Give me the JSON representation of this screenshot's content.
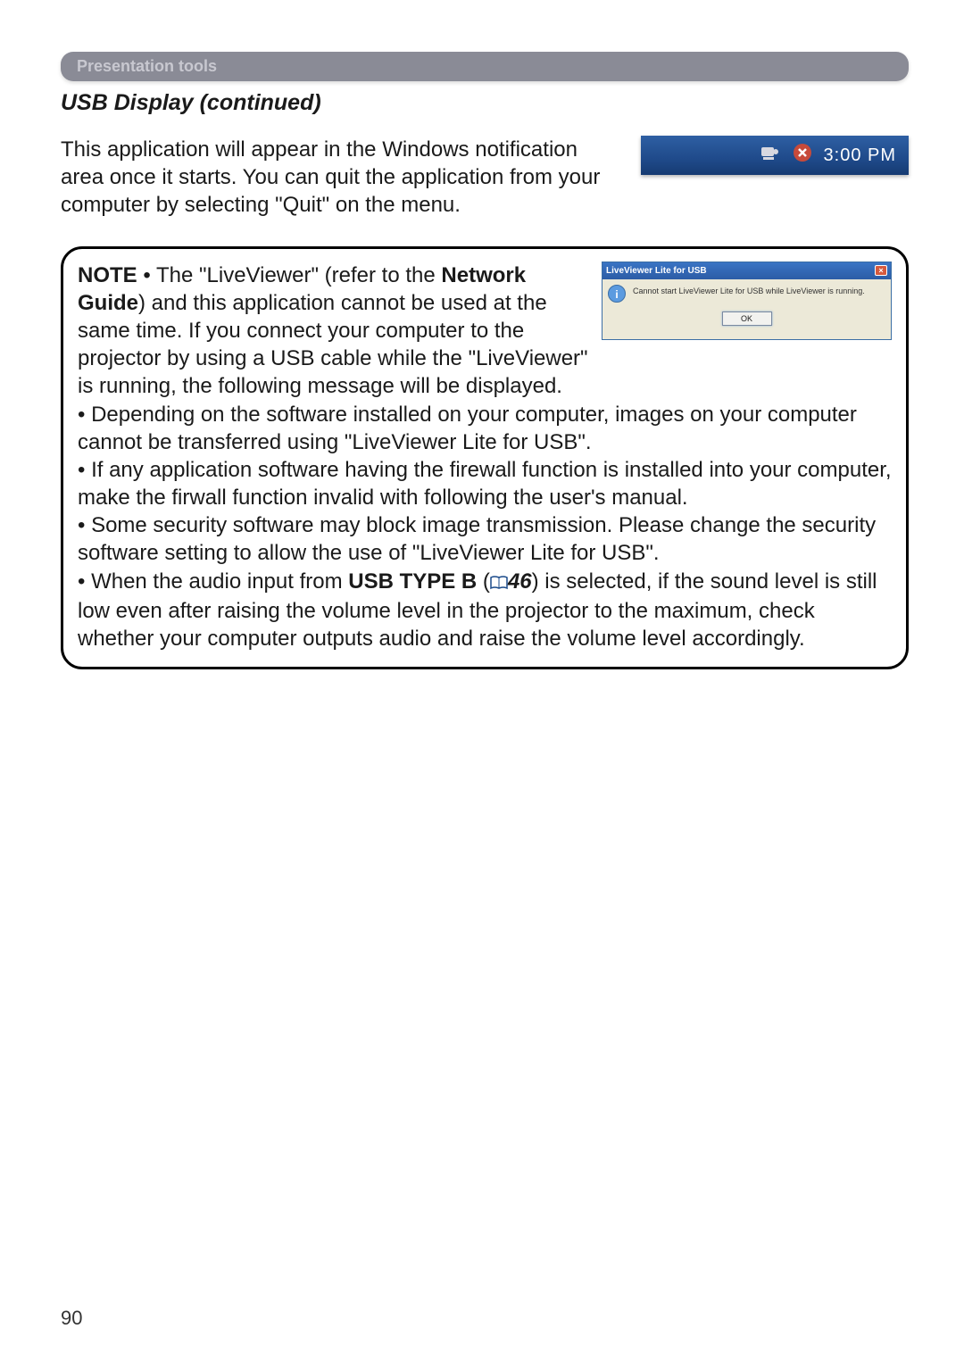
{
  "section_header": "Presentation tools",
  "page_title": "USB Display (continued)",
  "intro": "This application will appear in the Windows notification area once it starts. You can quit the application from your computer by selecting \"Quit\" on the menu.",
  "tray": {
    "time": "3:00 PM"
  },
  "dialog": {
    "title": "LiveViewer Lite for USB",
    "message": "Cannot start LiveViewer Lite for USB while LiveViewer is running.",
    "ok_label": "OK",
    "close_label": "×"
  },
  "note": {
    "label": "NOTE",
    "line1_prefix": "  • The \"LiveViewer\" (refer to the ",
    "bold1": "Network Guide",
    "line1_after": ") and this application cannot be used at the same time. If you connect your computer to the projector by using a USB cable while the \"LiveViewer\" is running, the following message will be displayed.",
    "bullet2": "• Depending on the software installed on your computer, images on your computer cannot be transferred using \"LiveViewer Lite for USB\".",
    "bullet3": "• If any application software having the firewall function is installed into your computer, make the firwall function invalid with following the user's manual.",
    "bullet4": "• Some security software may block image transmission. Please change the security software setting to allow the use of \"LiveViewer Lite for USB\".",
    "bullet5_prefix": "• When the audio input from ",
    "bold5": "USB TYPE B",
    "bullet5_paren_open": " (",
    "page_ref": "46",
    "bullet5_after": ") is selected, if the sound level is still low even after raising the volume level in the projector to the maximum, check whether your computer outputs audio and raise the volume level accordingly."
  },
  "page_number": "90"
}
